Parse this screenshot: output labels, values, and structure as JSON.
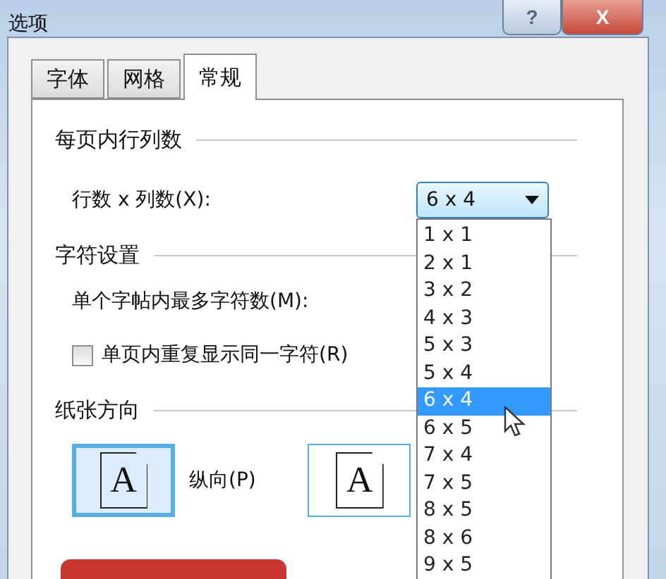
{
  "window": {
    "title": "选项",
    "buttons": [
      {
        "kind": "help",
        "label": "?"
      },
      {
        "kind": "close",
        "label": "X"
      }
    ]
  },
  "tabs": [
    {
      "label": "字体",
      "selected": false
    },
    {
      "label": "网格",
      "selected": false
    },
    {
      "label": "常规",
      "selected": true
    }
  ],
  "rows_per_page": {
    "title": "每页内行列数",
    "label": "行数 x 列数(X):",
    "combo": {
      "value": "6 x 4",
      "expanded": true,
      "options": [
        {
          "label": "1 x 1",
          "selected": false
        },
        {
          "label": "2 x 1",
          "selected": false
        },
        {
          "label": "3 x 2",
          "selected": false
        },
        {
          "label": "4 x 3",
          "selected": false
        },
        {
          "label": "5 x 3",
          "selected": false
        },
        {
          "label": "5 x 4",
          "selected": false
        },
        {
          "label": "6 x 4",
          "selected": true
        },
        {
          "label": "6 x 5",
          "selected": false
        },
        {
          "label": "7 x 4",
          "selected": false
        },
        {
          "label": "7 x 5",
          "selected": false
        },
        {
          "label": "8 x 5",
          "selected": false
        },
        {
          "label": "8 x 6",
          "selected": false
        },
        {
          "label": "9 x 5",
          "selected": false
        }
      ]
    }
  },
  "char_settings": {
    "title": "字符设置",
    "max_label": "单个字帖内最多字符数(M):",
    "repeat": {
      "label": "单页内重复显示同一字符(R)",
      "checked": false
    }
  },
  "orientation": {
    "title": "纸张方向",
    "options": [
      {
        "icon_letter": "A",
        "label": "纵向(P)",
        "selected": true
      },
      {
        "icon_letter": "A",
        "selected": false
      }
    ]
  }
}
